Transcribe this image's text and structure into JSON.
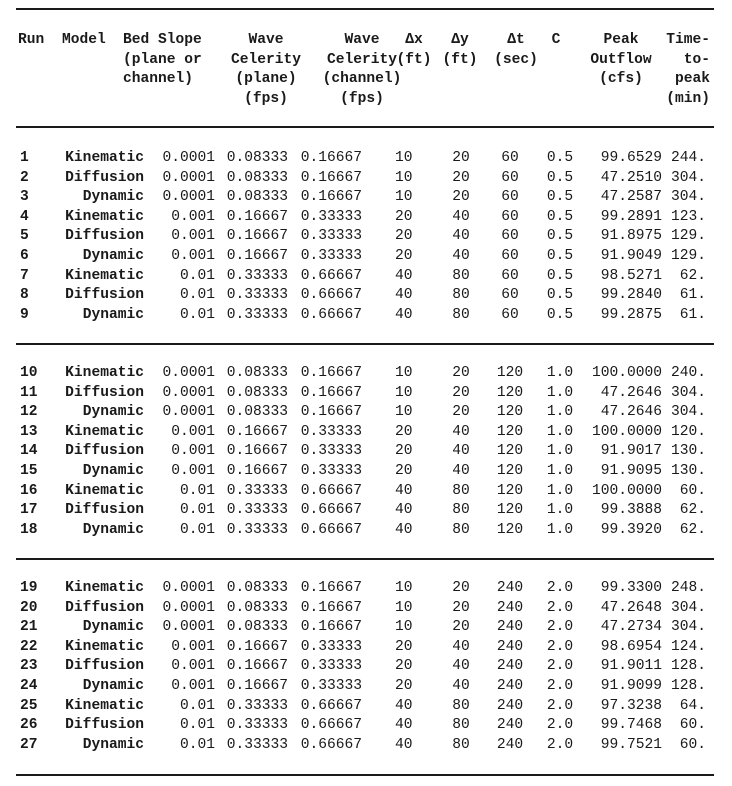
{
  "table": {
    "headers": [
      {
        "key": "run",
        "label": "Run"
      },
      {
        "key": "model",
        "label": "Model"
      },
      {
        "key": "bed_slope",
        "label": "Bed Slope\n(plane or\nchannel)"
      },
      {
        "key": "wave_celerity_plane",
        "label": "Wave\nCelerity\n(plane)\n(fps)"
      },
      {
        "key": "wave_celerity_channel",
        "label": "Wave\nCelerity\n(channel)\n(fps)"
      },
      {
        "key": "dx",
        "label": "Δx\n(ft)"
      },
      {
        "key": "dy",
        "label": "Δy\n(ft)"
      },
      {
        "key": "dt",
        "label": "Δt\n(sec)"
      },
      {
        "key": "c",
        "label": "C"
      },
      {
        "key": "peak_outflow",
        "label": "Peak\nOutflow\n(cfs)"
      },
      {
        "key": "time_to_peak",
        "label": "Time-\nto-\npeak\n(min)"
      }
    ],
    "groups": [
      {
        "rows": [
          {
            "run": "1",
            "model": "Kinematic",
            "bed_slope": "0.0001",
            "wave_celerity_plane": "0.08333",
            "wave_celerity_channel": "0.16667",
            "dx": "10",
            "dy": "20",
            "dt": "60",
            "c": "0.5",
            "peak_outflow": "99.6529",
            "time_to_peak": "244."
          },
          {
            "run": "2",
            "model": "Diffusion",
            "bed_slope": "0.0001",
            "wave_celerity_plane": "0.08333",
            "wave_celerity_channel": "0.16667",
            "dx": "10",
            "dy": "20",
            "dt": "60",
            "c": "0.5",
            "peak_outflow": "47.2510",
            "time_to_peak": "304."
          },
          {
            "run": "3",
            "model": "Dynamic",
            "bed_slope": "0.0001",
            "wave_celerity_plane": "0.08333",
            "wave_celerity_channel": "0.16667",
            "dx": "10",
            "dy": "20",
            "dt": "60",
            "c": "0.5",
            "peak_outflow": "47.2587",
            "time_to_peak": "304."
          },
          {
            "run": "4",
            "model": "Kinematic",
            "bed_slope": "0.001",
            "wave_celerity_plane": "0.16667",
            "wave_celerity_channel": "0.33333",
            "dx": "20",
            "dy": "40",
            "dt": "60",
            "c": "0.5",
            "peak_outflow": "99.2891",
            "time_to_peak": "123."
          },
          {
            "run": "5",
            "model": "Diffusion",
            "bed_slope": "0.001",
            "wave_celerity_plane": "0.16667",
            "wave_celerity_channel": "0.33333",
            "dx": "20",
            "dy": "40",
            "dt": "60",
            "c": "0.5",
            "peak_outflow": "91.8975",
            "time_to_peak": "129."
          },
          {
            "run": "6",
            "model": "Dynamic",
            "bed_slope": "0.001",
            "wave_celerity_plane": "0.16667",
            "wave_celerity_channel": "0.33333",
            "dx": "20",
            "dy": "40",
            "dt": "60",
            "c": "0.5",
            "peak_outflow": "91.9049",
            "time_to_peak": "129."
          },
          {
            "run": "7",
            "model": "Kinematic",
            "bed_slope": "0.01",
            "wave_celerity_plane": "0.33333",
            "wave_celerity_channel": "0.66667",
            "dx": "40",
            "dy": "80",
            "dt": "60",
            "c": "0.5",
            "peak_outflow": "98.5271",
            "time_to_peak": "62."
          },
          {
            "run": "8",
            "model": "Diffusion",
            "bed_slope": "0.01",
            "wave_celerity_plane": "0.33333",
            "wave_celerity_channel": "0.66667",
            "dx": "40",
            "dy": "80",
            "dt": "60",
            "c": "0.5",
            "peak_outflow": "99.2840",
            "time_to_peak": "61."
          },
          {
            "run": "9",
            "model": "Dynamic",
            "bed_slope": "0.01",
            "wave_celerity_plane": "0.33333",
            "wave_celerity_channel": "0.66667",
            "dx": "40",
            "dy": "80",
            "dt": "60",
            "c": "0.5",
            "peak_outflow": "99.2875",
            "time_to_peak": "61."
          }
        ]
      },
      {
        "rows": [
          {
            "run": "10",
            "model": "Kinematic",
            "bed_slope": "0.0001",
            "wave_celerity_plane": "0.08333",
            "wave_celerity_channel": "0.16667",
            "dx": "10",
            "dy": "20",
            "dt": "120",
            "c": "1.0",
            "peak_outflow": "100.0000",
            "time_to_peak": "240."
          },
          {
            "run": "11",
            "model": "Diffusion",
            "bed_slope": "0.0001",
            "wave_celerity_plane": "0.08333",
            "wave_celerity_channel": "0.16667",
            "dx": "10",
            "dy": "20",
            "dt": "120",
            "c": "1.0",
            "peak_outflow": "47.2646",
            "time_to_peak": "304."
          },
          {
            "run": "12",
            "model": "Dynamic",
            "bed_slope": "0.0001",
            "wave_celerity_plane": "0.08333",
            "wave_celerity_channel": "0.16667",
            "dx": "10",
            "dy": "20",
            "dt": "120",
            "c": "1.0",
            "peak_outflow": "47.2646",
            "time_to_peak": "304."
          },
          {
            "run": "13",
            "model": "Kinematic",
            "bed_slope": "0.001",
            "wave_celerity_plane": "0.16667",
            "wave_celerity_channel": "0.33333",
            "dx": "20",
            "dy": "40",
            "dt": "120",
            "c": "1.0",
            "peak_outflow": "100.0000",
            "time_to_peak": "120."
          },
          {
            "run": "14",
            "model": "Diffusion",
            "bed_slope": "0.001",
            "wave_celerity_plane": "0.16667",
            "wave_celerity_channel": "0.33333",
            "dx": "20",
            "dy": "40",
            "dt": "120",
            "c": "1.0",
            "peak_outflow": "91.9017",
            "time_to_peak": "130."
          },
          {
            "run": "15",
            "model": "Dynamic",
            "bed_slope": "0.001",
            "wave_celerity_plane": "0.16667",
            "wave_celerity_channel": "0.33333",
            "dx": "20",
            "dy": "40",
            "dt": "120",
            "c": "1.0",
            "peak_outflow": "91.9095",
            "time_to_peak": "130."
          },
          {
            "run": "16",
            "model": "Kinematic",
            "bed_slope": "0.01",
            "wave_celerity_plane": "0.33333",
            "wave_celerity_channel": "0.66667",
            "dx": "40",
            "dy": "80",
            "dt": "120",
            "c": "1.0",
            "peak_outflow": "100.0000",
            "time_to_peak": "60."
          },
          {
            "run": "17",
            "model": "Diffusion",
            "bed_slope": "0.01",
            "wave_celerity_plane": "0.33333",
            "wave_celerity_channel": "0.66667",
            "dx": "40",
            "dy": "80",
            "dt": "120",
            "c": "1.0",
            "peak_outflow": "99.3888",
            "time_to_peak": "62."
          },
          {
            "run": "18",
            "model": "Dynamic",
            "bed_slope": "0.01",
            "wave_celerity_plane": "0.33333",
            "wave_celerity_channel": "0.66667",
            "dx": "40",
            "dy": "80",
            "dt": "120",
            "c": "1.0",
            "peak_outflow": "99.3920",
            "time_to_peak": "62."
          }
        ]
      },
      {
        "rows": [
          {
            "run": "19",
            "model": "Kinematic",
            "bed_slope": "0.0001",
            "wave_celerity_plane": "0.08333",
            "wave_celerity_channel": "0.16667",
            "dx": "10",
            "dy": "20",
            "dt": "240",
            "c": "2.0",
            "peak_outflow": "99.3300",
            "time_to_peak": "248."
          },
          {
            "run": "20",
            "model": "Diffusion",
            "bed_slope": "0.0001",
            "wave_celerity_plane": "0.08333",
            "wave_celerity_channel": "0.16667",
            "dx": "10",
            "dy": "20",
            "dt": "240",
            "c": "2.0",
            "peak_outflow": "47.2648",
            "time_to_peak": "304."
          },
          {
            "run": "21",
            "model": "Dynamic",
            "bed_slope": "0.0001",
            "wave_celerity_plane": "0.08333",
            "wave_celerity_channel": "0.16667",
            "dx": "10",
            "dy": "20",
            "dt": "240",
            "c": "2.0",
            "peak_outflow": "47.2734",
            "time_to_peak": "304."
          },
          {
            "run": "22",
            "model": "Kinematic",
            "bed_slope": "0.001",
            "wave_celerity_plane": "0.16667",
            "wave_celerity_channel": "0.33333",
            "dx": "20",
            "dy": "40",
            "dt": "240",
            "c": "2.0",
            "peak_outflow": "98.6954",
            "time_to_peak": "124."
          },
          {
            "run": "23",
            "model": "Diffusion",
            "bed_slope": "0.001",
            "wave_celerity_plane": "0.16667",
            "wave_celerity_channel": "0.33333",
            "dx": "20",
            "dy": "40",
            "dt": "240",
            "c": "2.0",
            "peak_outflow": "91.9011",
            "time_to_peak": "128."
          },
          {
            "run": "24",
            "model": "Dynamic",
            "bed_slope": "0.001",
            "wave_celerity_plane": "0.16667",
            "wave_celerity_channel": "0.33333",
            "dx": "20",
            "dy": "40",
            "dt": "240",
            "c": "2.0",
            "peak_outflow": "91.9099",
            "time_to_peak": "128."
          },
          {
            "run": "25",
            "model": "Kinematic",
            "bed_slope": "0.01",
            "wave_celerity_plane": "0.33333",
            "wave_celerity_channel": "0.66667",
            "dx": "40",
            "dy": "80",
            "dt": "240",
            "c": "2.0",
            "peak_outflow": "97.3238",
            "time_to_peak": "64."
          },
          {
            "run": "26",
            "model": "Diffusion",
            "bed_slope": "0.01",
            "wave_celerity_plane": "0.33333",
            "wave_celerity_channel": "0.66667",
            "dx": "40",
            "dy": "80",
            "dt": "240",
            "c": "2.0",
            "peak_outflow": "99.7468",
            "time_to_peak": "60."
          },
          {
            "run": "27",
            "model": "Dynamic",
            "bed_slope": "0.01",
            "wave_celerity_plane": "0.33333",
            "wave_celerity_channel": "0.66667",
            "dx": "40",
            "dy": "80",
            "dt": "240",
            "c": "2.0",
            "peak_outflow": "99.7521",
            "time_to_peak": "60."
          }
        ]
      }
    ]
  }
}
